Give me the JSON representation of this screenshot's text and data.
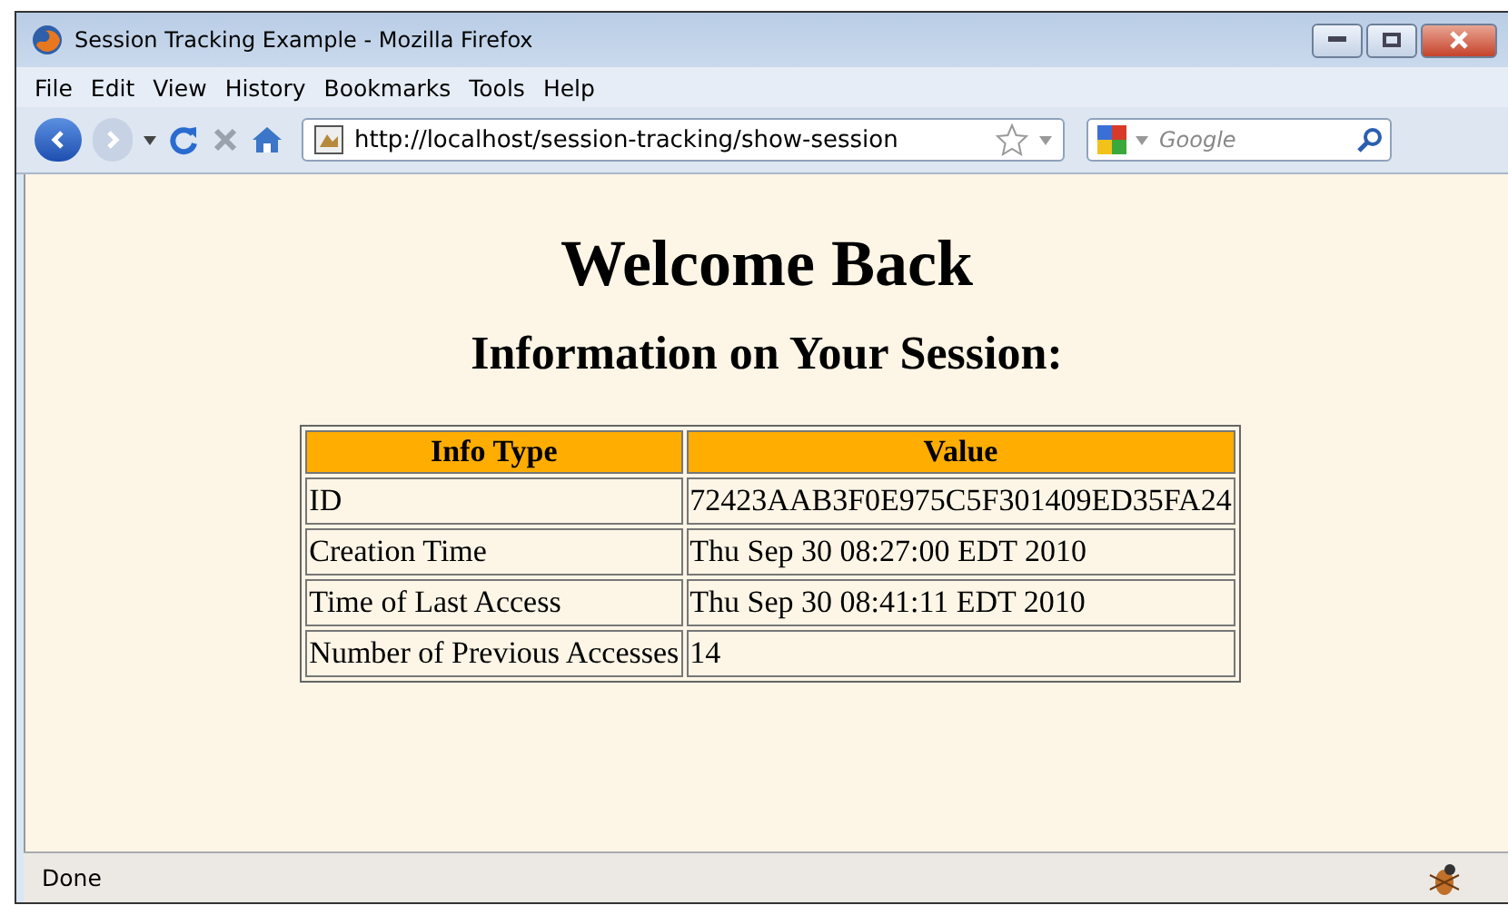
{
  "window": {
    "title": "Session Tracking Example - Mozilla Firefox"
  },
  "menu": [
    "File",
    "Edit",
    "View",
    "History",
    "Bookmarks",
    "Tools",
    "Help"
  ],
  "address_bar": {
    "value": "http://localhost/session-tracking/show-session"
  },
  "search": {
    "placeholder": "Google"
  },
  "page": {
    "heading": "Welcome Back",
    "subheading": "Information on Your Session:",
    "table": {
      "columns": [
        "Info Type",
        "Value"
      ],
      "rows": [
        [
          "ID",
          "72423AAB3F0E975C5F301409ED35FA24"
        ],
        [
          "Creation Time",
          "Thu Sep 30 08:27:00 EDT 2010"
        ],
        [
          "Time of Last Access",
          "Thu Sep 30 08:41:11 EDT 2010"
        ],
        [
          "Number of Previous Accesses",
          "14"
        ]
      ]
    }
  },
  "status_bar": {
    "text": "Done"
  }
}
